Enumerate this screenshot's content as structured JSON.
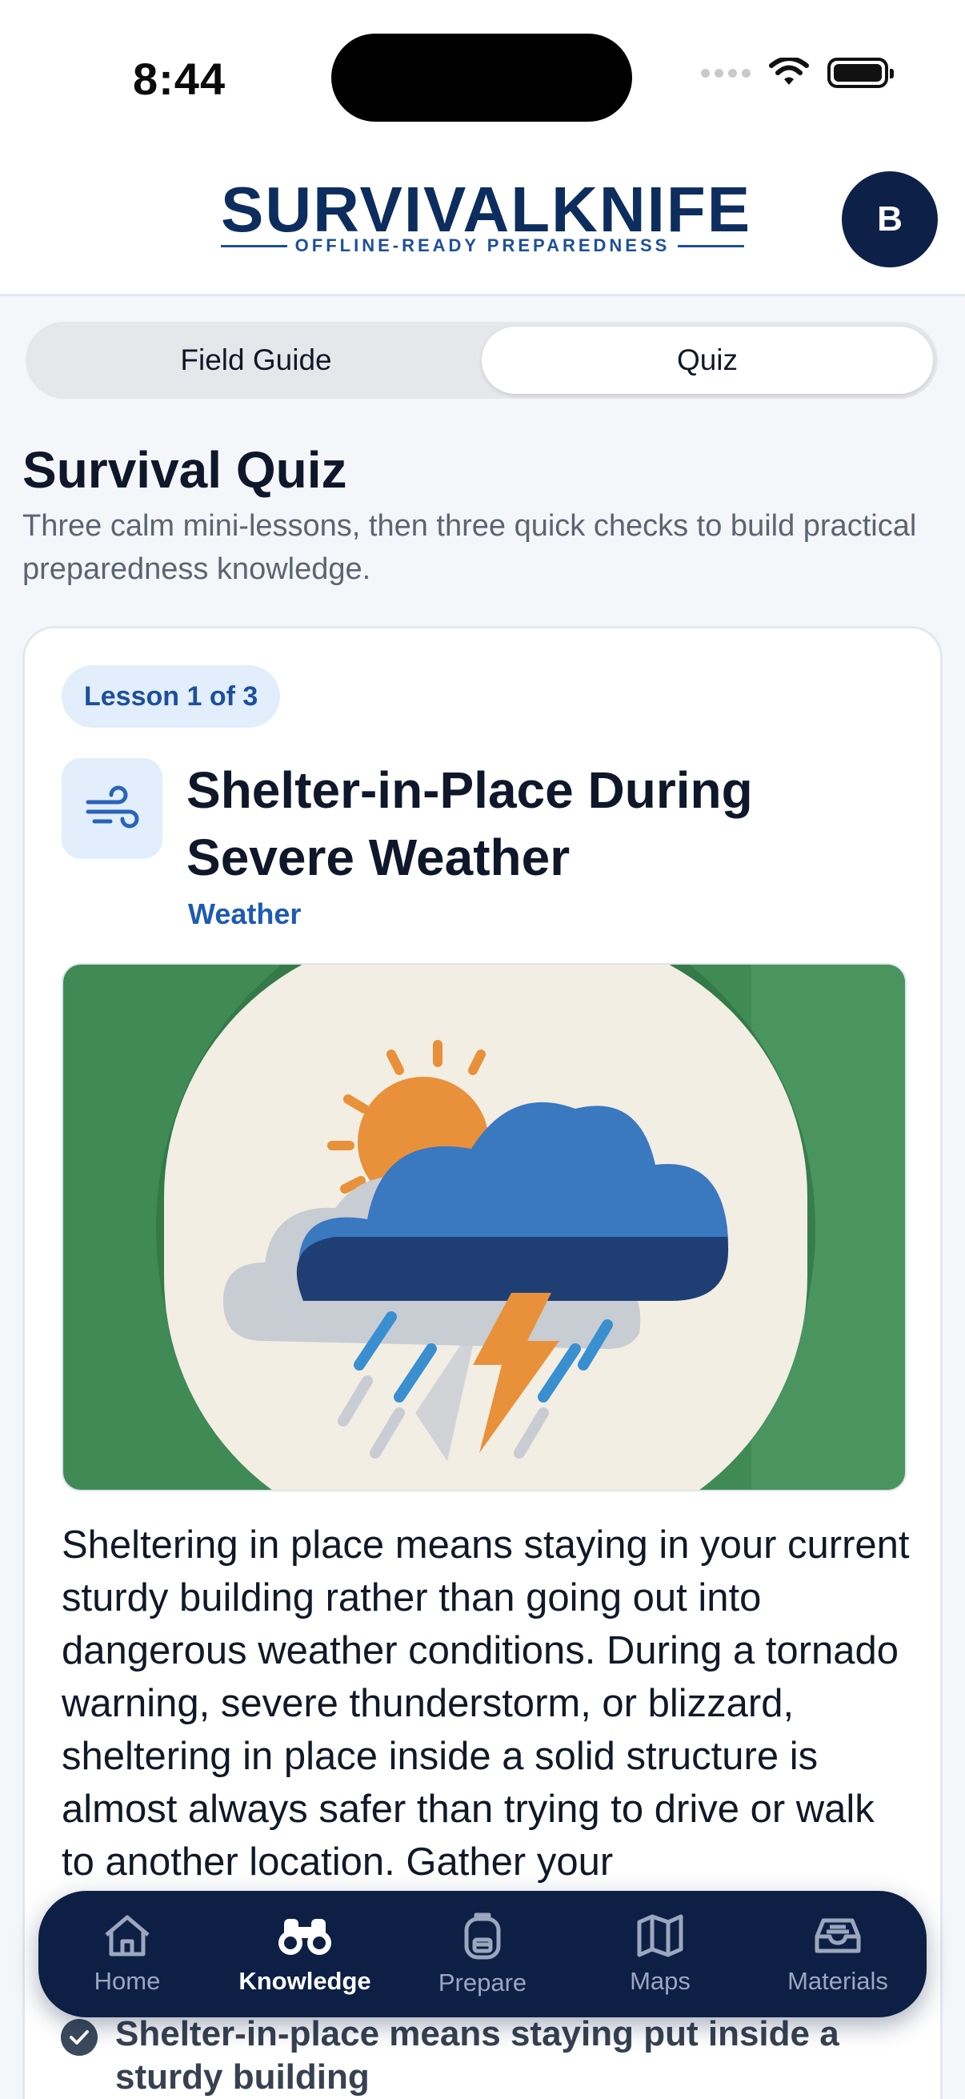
{
  "status": {
    "time": "8:44"
  },
  "header": {
    "brand": "SURVIVALKNIFE",
    "tagline": "OFFLINE-READY PREPAREDNESS",
    "avatar_initial": "B"
  },
  "segments": [
    {
      "label": "Field Guide",
      "active": false
    },
    {
      "label": "Quiz",
      "active": true
    }
  ],
  "page": {
    "title": "Survival Quiz",
    "description": "Three calm mini-lessons, then three quick checks to build practical preparedness knowledge."
  },
  "lesson": {
    "badge": "Lesson 1 of 3",
    "icon": "wind-icon",
    "title": "Shelter-in-Place During Severe Weather",
    "category": "Weather",
    "image": "storm-cloud-illustration",
    "body": "Sheltering in place means staying in your current sturdy building rather than going out into dangerous weather conditions. During a tornado warning, severe thunderstorm, or blizzard, sheltering in place inside a solid structure is almost always safer than trying to drive or walk to another location. Gather your"
  },
  "key_point": {
    "text": "Shelter-in-place means staying put inside a sturdy building"
  },
  "tabbar": {
    "items": [
      {
        "label": "Home",
        "icon": "home-icon",
        "active": false
      },
      {
        "label": "Knowledge",
        "icon": "binoculars-icon",
        "active": true
      },
      {
        "label": "Prepare",
        "icon": "backpack-icon",
        "active": false
      },
      {
        "label": "Maps",
        "icon": "map-icon",
        "active": false
      },
      {
        "label": "Materials",
        "icon": "tray-icon",
        "active": false
      }
    ]
  },
  "colors": {
    "brand_navy": "#0d2148",
    "accent_blue": "#1d4f9c",
    "image_green": "#3f8a55"
  }
}
